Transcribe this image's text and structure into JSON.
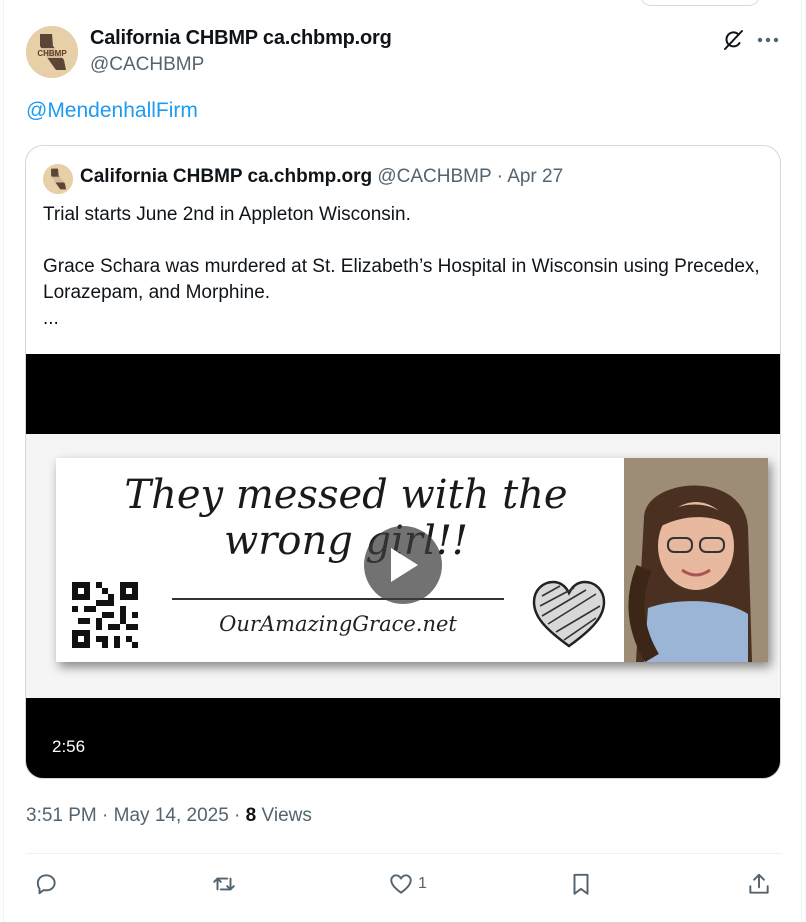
{
  "post": {
    "author_name": "California CHBMP ca.chbmp.org",
    "author_handle": "@CACHBMP",
    "avatar_text": "CHBMP",
    "mention": "@MendenhallFirm",
    "timestamp": "3:51 PM · May 14, 2025",
    "separator": " · ",
    "views_count": "8",
    "views_label": " Views"
  },
  "quoted": {
    "author_name": "California CHBMP ca.chbmp.org",
    "author_handle": "@CACHBMP",
    "date": "Apr 27",
    "text_lines": [
      "Trial starts June 2nd in Appleton Wisconsin.",
      "",
      "Grace Schara was murdered at St. Elizabeth’s Hospital in Wisconsin using Precedex, Lorazepam, and Morphine.",
      "..."
    ],
    "video": {
      "duration": "2:56",
      "banner_line1": "They messed with the",
      "banner_line2": "wrong girl!!",
      "banner_url": "OurAmazingGrace.net"
    }
  },
  "actions": {
    "reply": {
      "icon": "reply-icon",
      "count": ""
    },
    "repost": {
      "icon": "repost-icon",
      "count": ""
    },
    "like": {
      "icon": "heart-icon",
      "count": "1"
    },
    "bookmark": {
      "icon": "bookmark-icon",
      "count": ""
    },
    "share": {
      "icon": "share-icon",
      "count": ""
    }
  },
  "colors": {
    "link": "#1d9bf0",
    "secondary_text": "#536471",
    "primary_text": "#0f1419",
    "border": "#cfd9de"
  }
}
